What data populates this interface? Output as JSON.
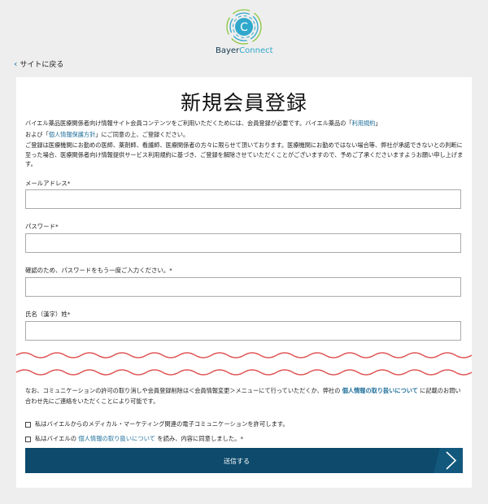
{
  "logo": {
    "letter": "C",
    "brand_a": "Bayer",
    "brand_b": "Connect"
  },
  "nav": {
    "back_label": "サイトに戻る"
  },
  "form": {
    "title": "新規会員登録",
    "intro1_pre": "バイエル薬品医療関係者向け情報サイト会員コンテンツをご利用いただくためには、会員登録が必要です。バイエル薬品の「",
    "intro1_link": "利用規約",
    "intro1_post": "」",
    "intro2_pre": "および「",
    "intro2_link": "個人情報保護方針",
    "intro2_post": "」にご同意の上、ご登録ください。",
    "intro3": "ご登録は医療機関にお勤めの医師、薬剤師、看護師、医療関係者の方々に限らせて頂いております。医療機関にお勤めではない場合等、弊社が承諾できないとの判断に至った場合、医療関係者向け情報提供サービス利用規約に基づき、ご登録を解除させていただくことがございますので、予めご了承くださいますようお願い申し上げます。",
    "fields": [
      {
        "label": "メールアドレス*",
        "value": ""
      },
      {
        "label": "パスワード*",
        "value": ""
      },
      {
        "label": "確認のため、パスワードをもう一度ご入力ください。*",
        "value": ""
      },
      {
        "label": "氏名（漢字）姓*",
        "value": ""
      }
    ],
    "note_pre": "なお、コミュニケーションの許可の取り消しや会員登録削除は＜会員情報変更＞メニューにて行っていただくか、弊社の",
    "note_link": "個人情報の取り扱いについて",
    "note_post": "に記載のお問い合わせ先にご連絡をいただくことにより可能です。",
    "consent1": "私はバイエルからのメディカル・マーケティング関連の電子コミュニケーションを許可します。",
    "consent2_pre": "私はバイエルの",
    "consent2_link": "個人情報の取り扱いについて",
    "consent2_post": "を読み、内容に同意しました。*",
    "submit_label": "送信する"
  },
  "colors": {
    "brand_dark": "#0d4a6b",
    "link": "#1f6f9a",
    "wave": "#e05252",
    "logo_teal": "#2fa8cc",
    "logo_green": "#8cc63e"
  }
}
